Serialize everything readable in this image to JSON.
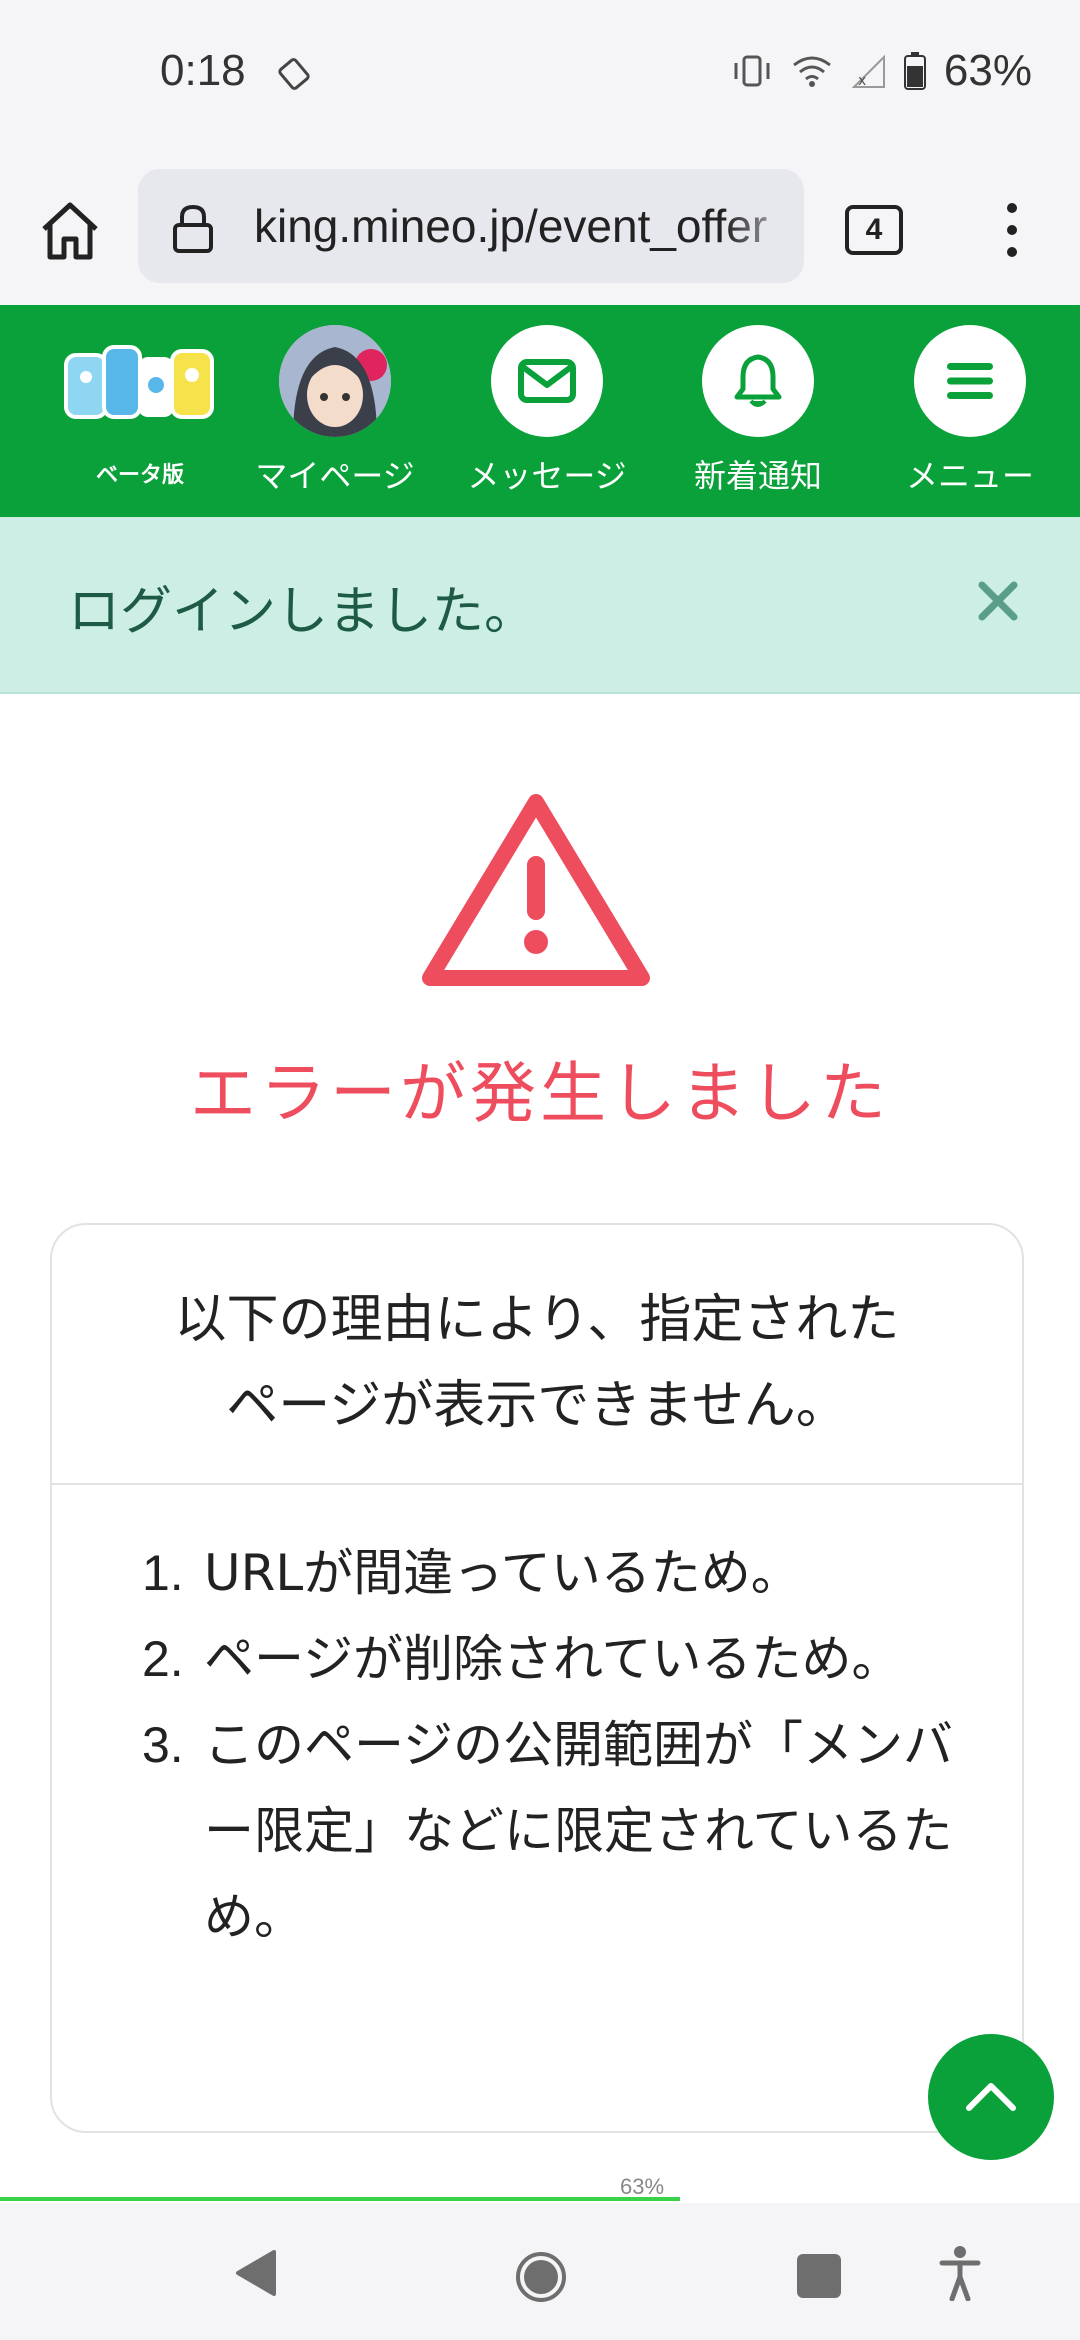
{
  "status_bar": {
    "time": "0:18",
    "battery": "63%"
  },
  "browser": {
    "url": "king.mineo.jp/event_offer",
    "tab_count": "4"
  },
  "nav": {
    "logo_subtitle": "ベータ版",
    "items": [
      {
        "label": "マイページ",
        "icon": "avatar"
      },
      {
        "label": "メッセージ",
        "icon": "envelope-icon"
      },
      {
        "label": "新着通知",
        "icon": "bell-icon"
      },
      {
        "label": "メニュー",
        "icon": "hamburger-icon"
      }
    ],
    "color": "#0aa13a"
  },
  "banner": {
    "text": "ログインしました。",
    "color": "#cdeee4"
  },
  "error": {
    "title": "エラーが発生しました",
    "color": "#ee4d5e",
    "intro_line1": "以下の理由により、指定された",
    "intro_line2": "ページが表示できません。",
    "reasons": [
      {
        "num": "1.",
        "text": "URLが間違っているため。"
      },
      {
        "num": "2.",
        "text": "ページが削除されているため。"
      },
      {
        "num": "3.",
        "text": "このページの公開範囲が「メンバー限定」などに限定されているため。"
      }
    ]
  },
  "page_load": {
    "progress_label": "63%",
    "progress": 0.63
  }
}
